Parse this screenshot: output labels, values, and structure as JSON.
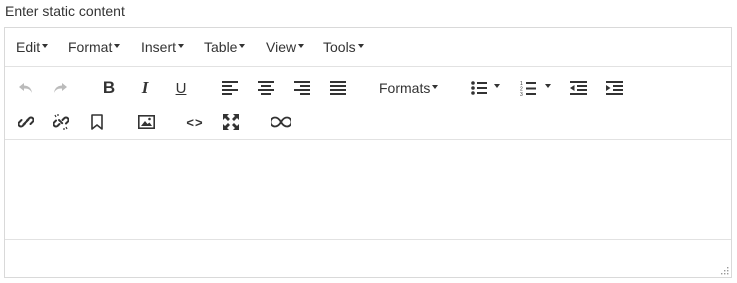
{
  "label": "Enter static content",
  "menubar": [
    {
      "label": "Edit"
    },
    {
      "label": "Format"
    },
    {
      "label": "Insert"
    },
    {
      "label": "Table"
    },
    {
      "label": "View"
    },
    {
      "label": "Tools"
    }
  ],
  "toolbar": {
    "formats_label": "Formats",
    "buttons_row1": [
      "undo-icon",
      "redo-icon",
      "bold-icon",
      "italic-icon",
      "underline-icon",
      "align-left-icon",
      "align-center-icon",
      "align-right-icon",
      "align-justify-icon",
      "bullet-list-icon",
      "numbered-list-icon",
      "outdent-icon",
      "indent-icon"
    ],
    "buttons_row2": [
      "link-icon",
      "unlink-icon",
      "bookmark-icon",
      "image-icon",
      "code-icon",
      "fullscreen-icon",
      "infinity-icon"
    ],
    "bold_glyph": "B",
    "italic_glyph": "I",
    "underline_glyph": "U",
    "code_glyph": "<>"
  },
  "editor": {
    "content": ""
  },
  "colors": {
    "icon": "#333333",
    "disabled_icon": "#bbbbbb",
    "border": "#d9d9d9"
  }
}
